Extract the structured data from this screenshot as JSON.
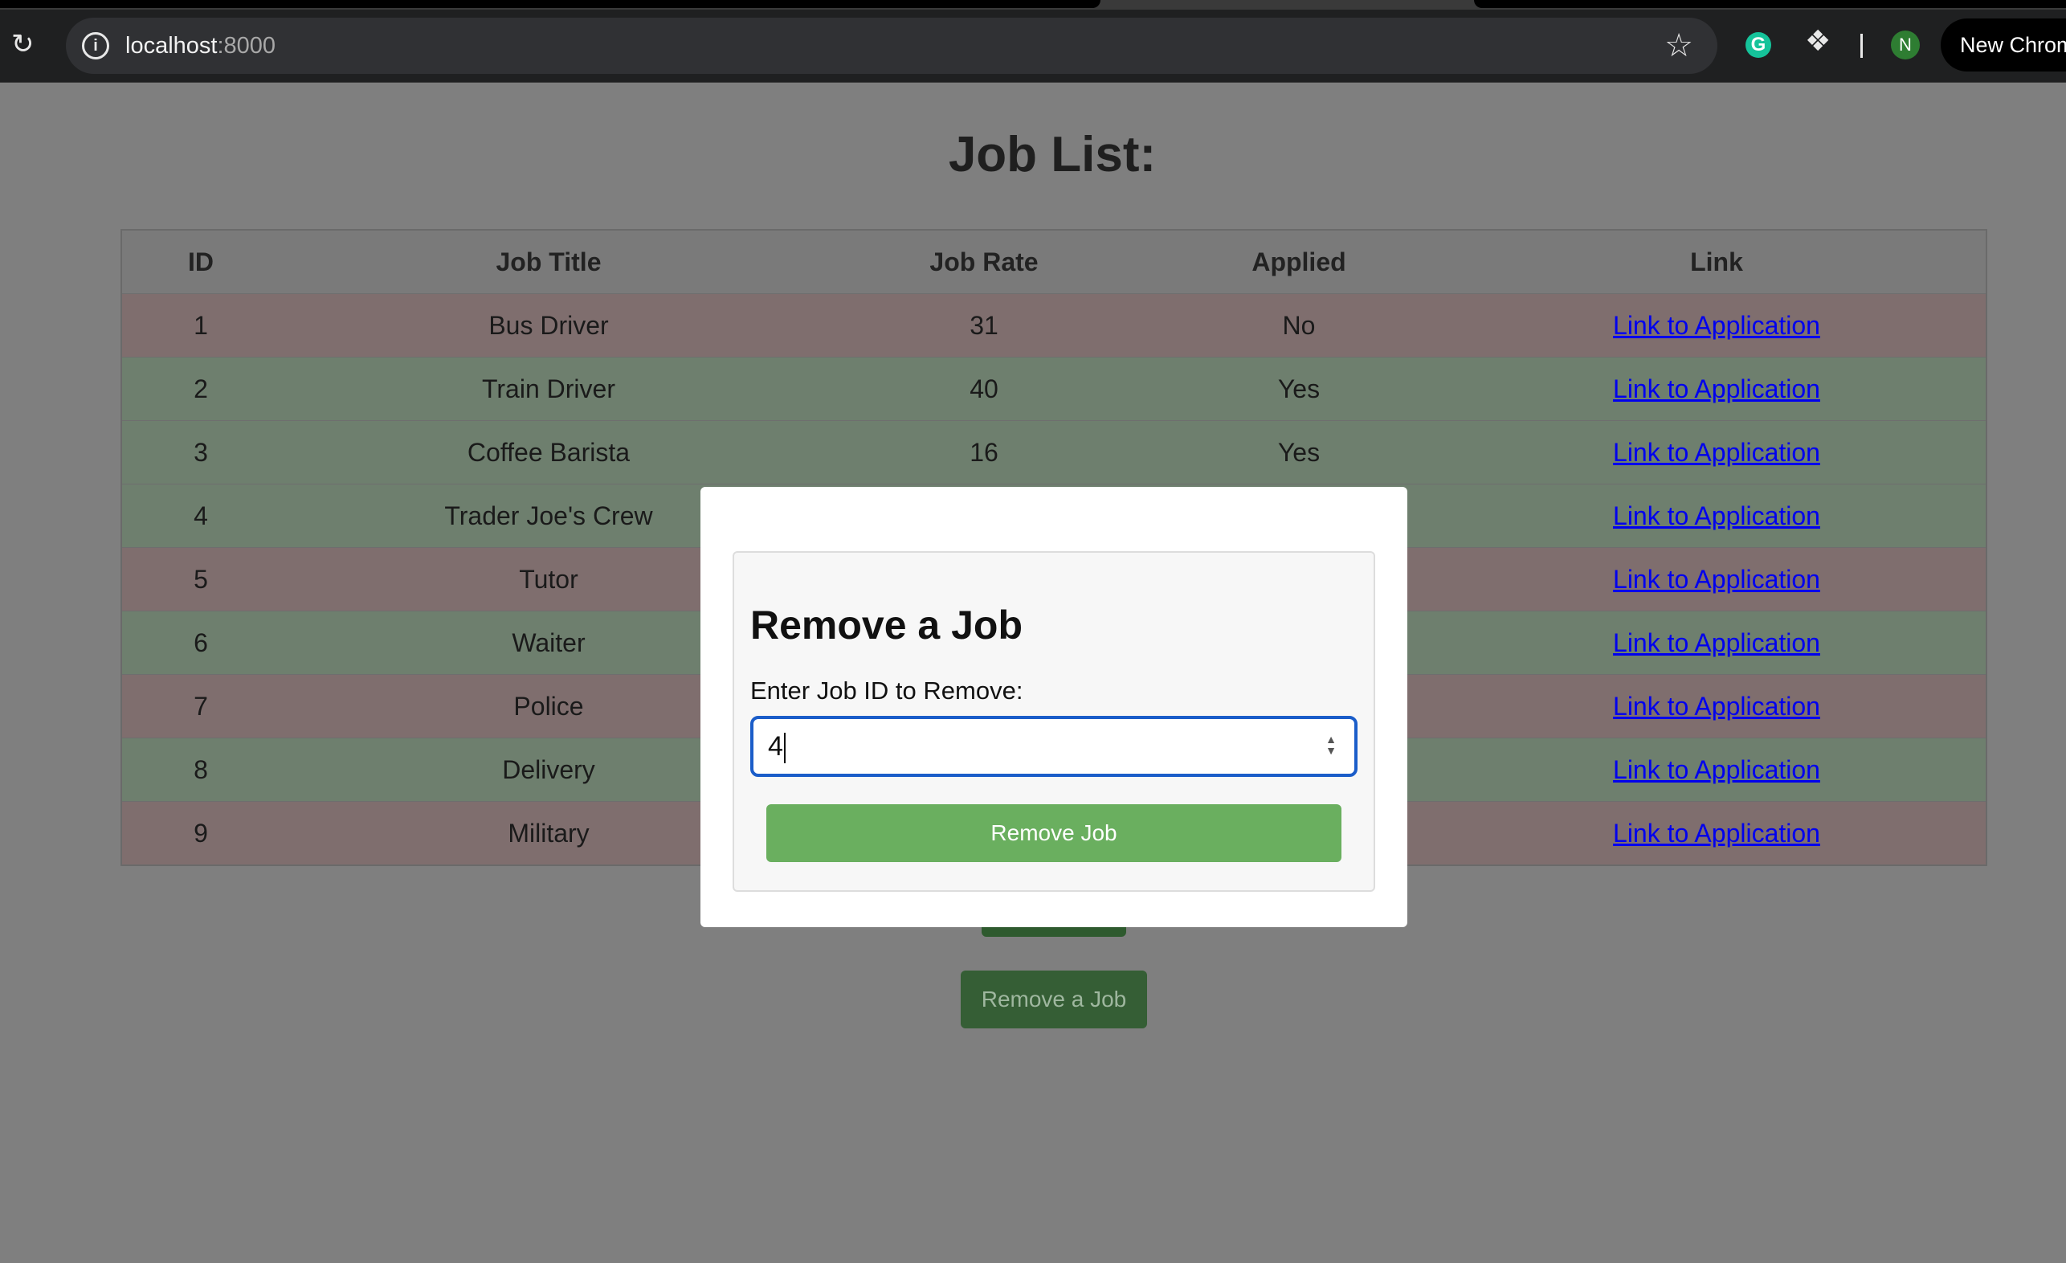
{
  "browser": {
    "url_host": "localhost",
    "url_port": ":8000",
    "avatar_letter": "N",
    "new_chrome_label": "New Chrome",
    "grammarly_letter": "G"
  },
  "page": {
    "title": "Job List:",
    "columns": [
      "ID",
      "Job Title",
      "Job Rate",
      "Applied",
      "Link"
    ],
    "rows": [
      {
        "id": "1",
        "title": "Bus Driver",
        "rate": "31",
        "applied": "No",
        "link": "Link to Application"
      },
      {
        "id": "2",
        "title": "Train Driver",
        "rate": "40",
        "applied": "Yes",
        "link": "Link to Application"
      },
      {
        "id": "3",
        "title": "Coffee Barista",
        "rate": "16",
        "applied": "Yes",
        "link": "Link to Application"
      },
      {
        "id": "4",
        "title": "Trader Joe's Crew",
        "rate": "",
        "applied": "",
        "link": "Link to Application"
      },
      {
        "id": "5",
        "title": "Tutor",
        "rate": "",
        "applied": "",
        "link": "Link to Application"
      },
      {
        "id": "6",
        "title": "Waiter",
        "rate": "",
        "applied": "",
        "link": "Link to Application"
      },
      {
        "id": "7",
        "title": "Police",
        "rate": "",
        "applied": "",
        "link": "Link to Application"
      },
      {
        "id": "8",
        "title": "Delivery",
        "rate": "",
        "applied": "",
        "link": "Link to Application"
      },
      {
        "id": "9",
        "title": "Military",
        "rate": "",
        "applied": "",
        "link": "Link to Application"
      }
    ],
    "remove_open_button": "Remove a Job"
  },
  "modal": {
    "title": "Remove a Job",
    "label": "Enter Job ID to Remove:",
    "input_value": "4",
    "submit_label": "Remove Job"
  },
  "colors": {
    "row_no": "#7f6e6e",
    "row_yes": "#6e7f6e",
    "button_green": "#6aaf5f",
    "link_blue": "#0000ee",
    "input_focus": "#1b5dc9"
  }
}
